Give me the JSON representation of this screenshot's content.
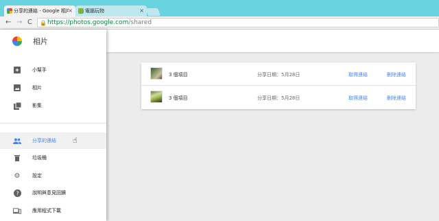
{
  "browser": {
    "tabs": [
      {
        "label": "分享的連結 - Google 相片",
        "active": true
      },
      {
        "label": "電腦玩物",
        "active": false
      }
    ],
    "nav": {
      "back": "←",
      "forward": "→",
      "reload": "C"
    },
    "url": {
      "scheme": "https://",
      "host": "photos.google.com",
      "path": "/shared"
    }
  },
  "app": {
    "title": "相片"
  },
  "sidebar": {
    "items": [
      {
        "label": "小幫手",
        "icon": "assistant-icon"
      },
      {
        "label": "相片",
        "icon": "photos-icon"
      },
      {
        "label": "影集",
        "icon": "albums-icon"
      },
      {
        "label": "分享的連結",
        "icon": "shared-people-icon",
        "active": true
      },
      {
        "label": "垃圾桶",
        "icon": "trash-icon"
      },
      {
        "label": "設定",
        "icon": "gear-icon"
      },
      {
        "label": "說明與意見回饋",
        "icon": "help-icon"
      },
      {
        "label": "應用程式下載",
        "icon": "devices-icon"
      }
    ]
  },
  "shared_links": {
    "rows": [
      {
        "count": "3 個項目",
        "date": "分享日期：5月28日",
        "get_link": "取得連結",
        "delete_link": "刪除連結"
      },
      {
        "count": "3 個項目",
        "date": "分享日期：5月28日",
        "get_link": "取得連結",
        "delete_link": "刪除連結"
      }
    ]
  },
  "colors": {
    "accent": "#4285f4",
    "tabstrip": "#6ad3e0",
    "secure": "#0b8043"
  }
}
